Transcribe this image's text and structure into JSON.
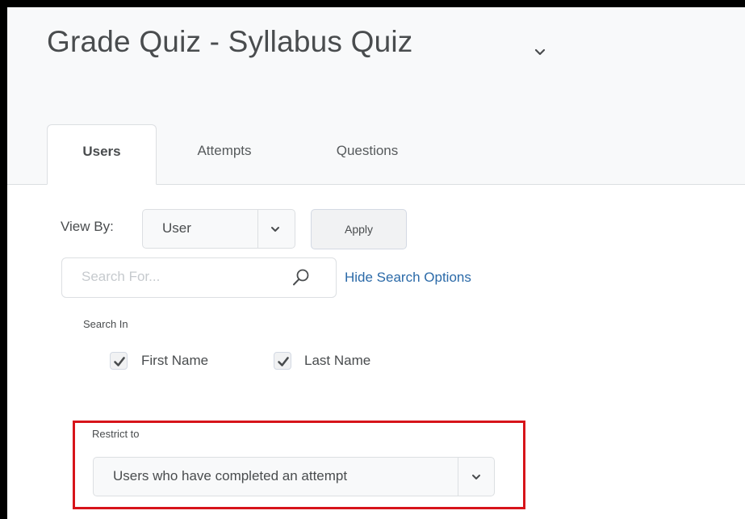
{
  "page": {
    "title": "Grade Quiz - Syllabus Quiz"
  },
  "tabs": [
    {
      "label": "Users",
      "active": true
    },
    {
      "label": "Attempts",
      "active": false
    },
    {
      "label": "Questions",
      "active": false
    }
  ],
  "view_by": {
    "label": "View By:",
    "selected": "User",
    "apply_label": "Apply"
  },
  "search": {
    "placeholder": "Search For...",
    "value": "",
    "hide_options_label": "Hide Search Options"
  },
  "search_in": {
    "label": "Search In",
    "options": [
      {
        "label": "First Name",
        "checked": true
      },
      {
        "label": "Last Name",
        "checked": true
      }
    ]
  },
  "restrict_to": {
    "label": "Restrict to",
    "selected": "Users who have completed an attempt"
  },
  "colors": {
    "link": "#2b6aa8",
    "highlight": "#d7141a",
    "text": "#494c4e",
    "placeholder": "#c6cace"
  }
}
